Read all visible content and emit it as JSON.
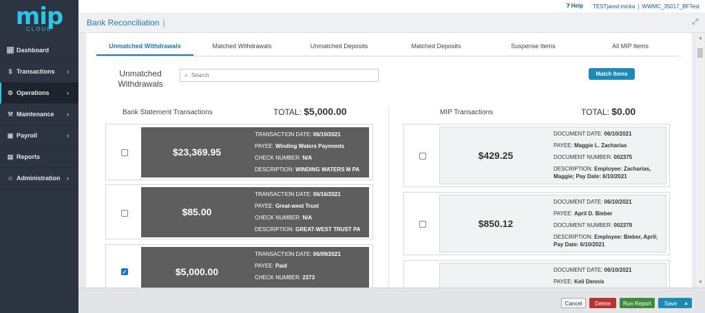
{
  "app": {
    "logo_text": "mip",
    "logo_sub": "CLOUD"
  },
  "topbar": {
    "help": "Help",
    "user": "TESTjared.micka",
    "org": "WWMC_35017_BFTest"
  },
  "page": {
    "title": "Bank Reconciliation",
    "title_sep": "|"
  },
  "sidebar": {
    "items": [
      {
        "label": "Dashboard",
        "icon": "chart-icon"
      },
      {
        "label": "Transactions",
        "icon": "dollar-icon"
      },
      {
        "label": "Operations",
        "icon": "gears-icon"
      },
      {
        "label": "Maintenance",
        "icon": "wrench-icon"
      },
      {
        "label": "Payroll",
        "icon": "wallet-icon"
      },
      {
        "label": "Reports",
        "icon": "document-icon"
      },
      {
        "label": "Administration",
        "icon": "users-icon"
      }
    ]
  },
  "tabs": [
    "Unmatched Withdrawals",
    "Matched Withdrawals",
    "Unmatched Deposits",
    "Matched Deposits",
    "Suspense Items",
    "All MIP Items"
  ],
  "section": {
    "label_line1": "Unmatched",
    "label_line2": "Withdrawals"
  },
  "search": {
    "placeholder": "Search"
  },
  "match_button": "Match Items",
  "bank": {
    "heading": "Bank Statement Transactions",
    "total_label": "TOTAL:",
    "total_value": "$5,000.00",
    "items": [
      {
        "amount": "$23,369.95",
        "date_label": "TRANSACTION DATE:",
        "date": "06/10/2021",
        "payee_label": "PAYEE:",
        "payee": "Winding Waters Payments",
        "check_label": "CHECK NUMBER:",
        "check": "N/A",
        "desc_label": "DESCRIPTION:",
        "desc": "WINDING WATERS M PA",
        "checked": false
      },
      {
        "amount": "$85.00",
        "date_label": "TRANSACTION DATE:",
        "date": "06/16/2021",
        "payee_label": "PAYEE:",
        "payee": "Great-west Trust",
        "check_label": "CHECK NUMBER:",
        "check": "N/A",
        "desc_label": "DESCRIPTION:",
        "desc": "GREAT-WEST TRUST PA",
        "checked": false
      },
      {
        "amount": "$5,000.00",
        "date_label": "TRANSACTION DATE:",
        "date": "06/09/2021",
        "payee_label": "PAYEE:",
        "payee": "Paid",
        "check_label": "CHECK NUMBER:",
        "check": "2373",
        "checked": true
      }
    ]
  },
  "mip": {
    "heading": "MIP Transactions",
    "total_label": "TOTAL:",
    "total_value": "$0.00",
    "items": [
      {
        "amount": "$429.25",
        "date_label": "DOCUMENT DATE:",
        "date": "06/10/2021",
        "payee_label": "PAYEE:",
        "payee": "Maggie L. Zacharias",
        "doc_label": "DOCUMENT NUMBER:",
        "doc": "002375",
        "desc_label": "DESCRIPTION:",
        "desc": "Employee: Zacharias,",
        "desc2": "Maggie; Pay Date: 6/10/2021"
      },
      {
        "amount": "$850.12",
        "date_label": "DOCUMENT DATE:",
        "date": "06/10/2021",
        "payee_label": "PAYEE:",
        "payee": "April D. Bieber",
        "doc_label": "DOCUMENT NUMBER:",
        "doc": "002379",
        "desc_label": "DESCRIPTION:",
        "desc": "Employee: Bieber, April;",
        "desc2": "Pay Date: 6/10/2021"
      },
      {
        "date_label": "DOCUMENT DATE:",
        "date": "06/10/2021",
        "payee_label": "PAYEE:",
        "payee": "Keli Dennis"
      }
    ]
  },
  "actions": {
    "cancel": "Cancel",
    "delete": "Delete",
    "run_report": "Run Report",
    "save": "Save"
  }
}
